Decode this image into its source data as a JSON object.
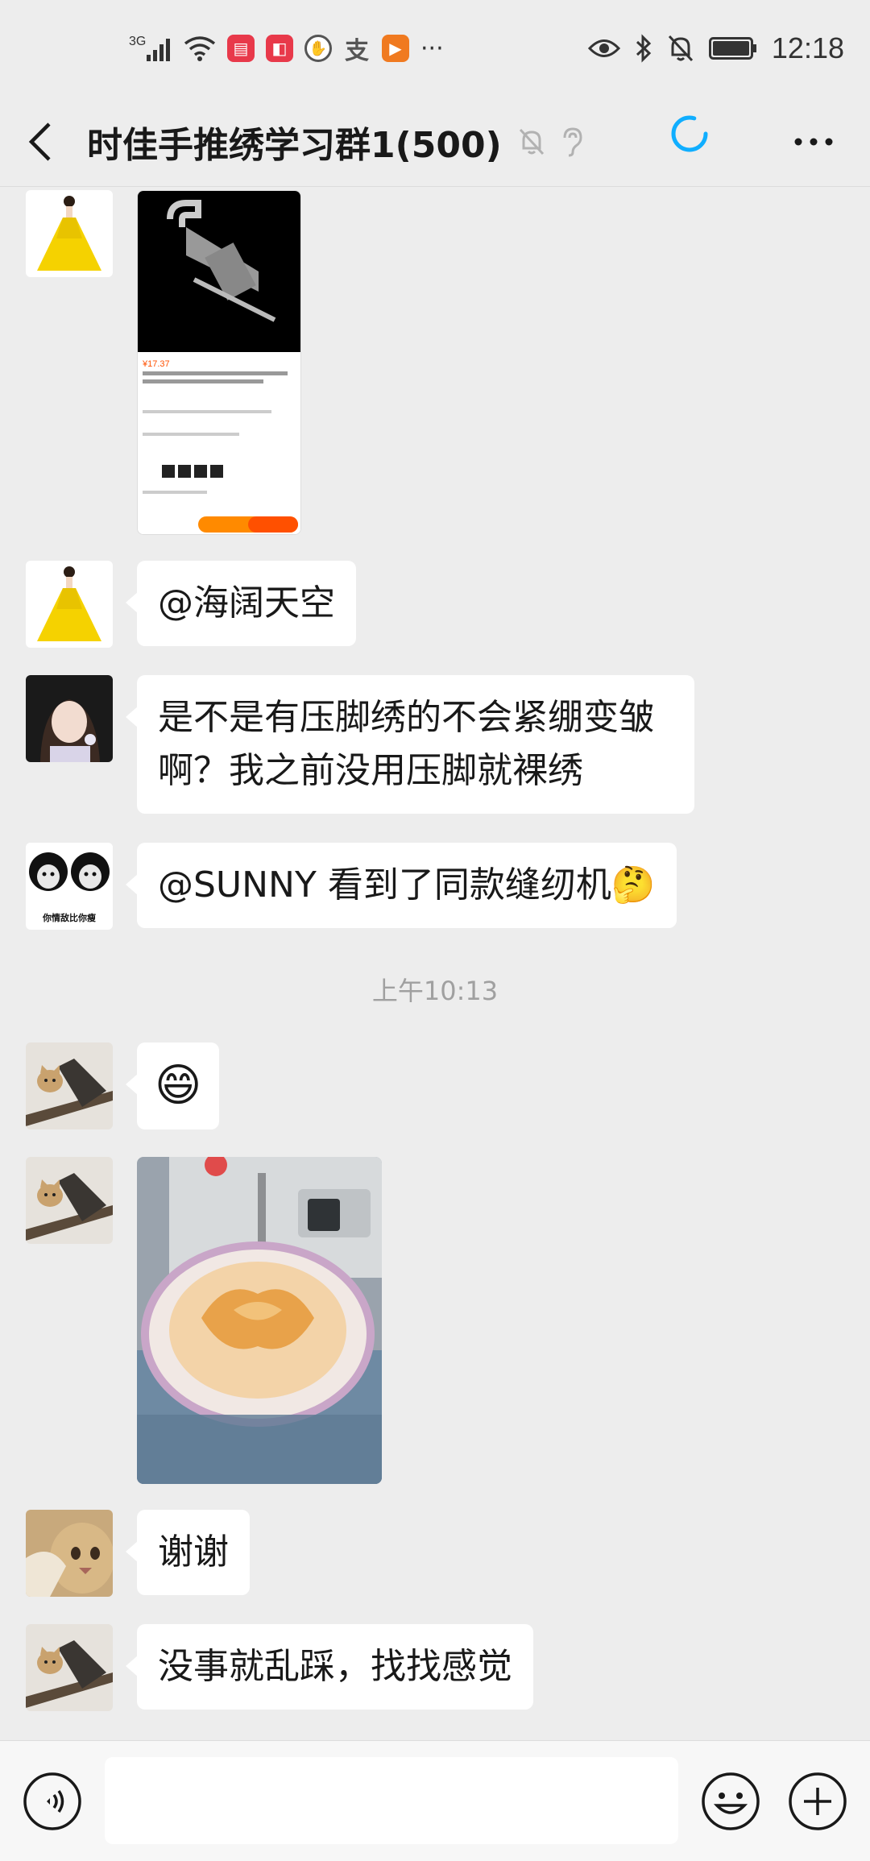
{
  "status_bar": {
    "network": "3G",
    "clock": "12:18",
    "apps": [
      {
        "name": "reader-app",
        "glyph": "▤",
        "color": "#e8394a"
      },
      {
        "name": "shop-app",
        "glyph": "◧",
        "color": "#e8394a"
      },
      {
        "name": "hand-app",
        "glyph": "✋",
        "color": "#555555"
      },
      {
        "name": "alipay-app",
        "glyph": "支",
        "color": "#555555"
      },
      {
        "name": "video-app",
        "glyph": "▶",
        "color": "#f07a20"
      }
    ],
    "more": "···"
  },
  "header": {
    "title": "时佳手推绣学习群1(500)",
    "accent_color": "#10aeff"
  },
  "messages": [
    {
      "type": "image",
      "sender_avatar": "yellow-dress-girl",
      "image_desc": "product-screenshot",
      "price": "¥17.37"
    },
    {
      "type": "text",
      "sender_avatar": "yellow-dress-girl",
      "text": "@海阔天空"
    },
    {
      "type": "text",
      "sender_avatar": "girl-portrait",
      "lines": [
        "是不是有压脚绣的不会紧绷变皱",
        "啊？我之前没用压脚就裸绣"
      ]
    },
    {
      "type": "text",
      "sender_avatar": "panda-meme",
      "avatar_caption": "你情敌比你瘦",
      "text": "@SUNNY  看到了同款缝纫机",
      "emoji": "🤔"
    },
    {
      "type": "timestamp",
      "text": "上午10:13"
    },
    {
      "type": "emoji",
      "sender_avatar": "cat-on-branch",
      "emoji": "😄"
    },
    {
      "type": "image",
      "sender_avatar": "cat-on-branch",
      "image_desc": "embroidery-sewing-machine-photo"
    },
    {
      "type": "text",
      "sender_avatar": "cat-closeup",
      "text": "谢谢"
    },
    {
      "type": "text",
      "sender_avatar": "cat-on-branch",
      "text": "没事就乱踩，找找感觉"
    }
  ],
  "input_bar": {
    "placeholder": "",
    "value": ""
  }
}
